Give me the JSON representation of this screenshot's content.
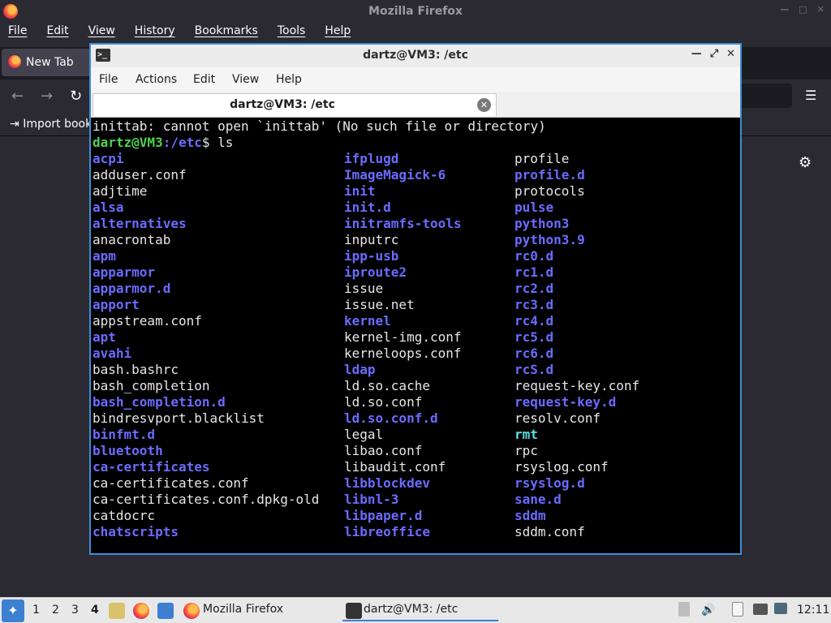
{
  "firefox": {
    "window_title": "Mozilla Firefox",
    "menu": [
      "File",
      "Edit",
      "View",
      "History",
      "Bookmarks",
      "Tools",
      "Help"
    ],
    "tab_label": "New Tab",
    "bookmark_label": "Import book"
  },
  "terminal": {
    "window_title": "dartz@VM3: /etc",
    "menu": [
      "File",
      "Actions",
      "Edit",
      "View",
      "Help"
    ],
    "tab_label": "dartz@VM3: /etc",
    "error_line": "inittab: cannot open `inittab' (No such file or directory)",
    "prompt_user": "dartz@VM3",
    "prompt_path": ":/etc",
    "prompt_rest": "$ ls",
    "columns": [
      [
        {
          "name": "acpi",
          "type": "dir"
        },
        {
          "name": "adduser.conf",
          "type": "file"
        },
        {
          "name": "adjtime",
          "type": "file"
        },
        {
          "name": "alsa",
          "type": "dir"
        },
        {
          "name": "alternatives",
          "type": "dir"
        },
        {
          "name": "anacrontab",
          "type": "file"
        },
        {
          "name": "apm",
          "type": "dir"
        },
        {
          "name": "apparmor",
          "type": "dir"
        },
        {
          "name": "apparmor.d",
          "type": "dir"
        },
        {
          "name": "apport",
          "type": "dir"
        },
        {
          "name": "appstream.conf",
          "type": "file"
        },
        {
          "name": "apt",
          "type": "dir"
        },
        {
          "name": "avahi",
          "type": "dir"
        },
        {
          "name": "bash.bashrc",
          "type": "file"
        },
        {
          "name": "bash_completion",
          "type": "file"
        },
        {
          "name": "bash_completion.d",
          "type": "dir"
        },
        {
          "name": "bindresvport.blacklist",
          "type": "file"
        },
        {
          "name": "binfmt.d",
          "type": "dir"
        },
        {
          "name": "bluetooth",
          "type": "dir"
        },
        {
          "name": "ca-certificates",
          "type": "dir"
        },
        {
          "name": "ca-certificates.conf",
          "type": "file"
        },
        {
          "name": "ca-certificates.conf.dpkg-old",
          "type": "file"
        },
        {
          "name": "catdocrc",
          "type": "file"
        },
        {
          "name": "chatscripts",
          "type": "dir"
        }
      ],
      [
        {
          "name": "ifplugd",
          "type": "dir"
        },
        {
          "name": "ImageMagick-6",
          "type": "dir"
        },
        {
          "name": "init",
          "type": "dir"
        },
        {
          "name": "init.d",
          "type": "dir"
        },
        {
          "name": "initramfs-tools",
          "type": "dir"
        },
        {
          "name": "inputrc",
          "type": "file"
        },
        {
          "name": "ipp-usb",
          "type": "dir"
        },
        {
          "name": "iproute2",
          "type": "dir"
        },
        {
          "name": "issue",
          "type": "file"
        },
        {
          "name": "issue.net",
          "type": "file"
        },
        {
          "name": "kernel",
          "type": "dir"
        },
        {
          "name": "kernel-img.conf",
          "type": "file"
        },
        {
          "name": "kerneloops.conf",
          "type": "file"
        },
        {
          "name": "ldap",
          "type": "dir"
        },
        {
          "name": "ld.so.cache",
          "type": "file"
        },
        {
          "name": "ld.so.conf",
          "type": "file"
        },
        {
          "name": "ld.so.conf.d",
          "type": "dir"
        },
        {
          "name": "legal",
          "type": "file"
        },
        {
          "name": "libao.conf",
          "type": "file"
        },
        {
          "name": "libaudit.conf",
          "type": "file"
        },
        {
          "name": "libblockdev",
          "type": "dir"
        },
        {
          "name": "libnl-3",
          "type": "dir"
        },
        {
          "name": "libpaper.d",
          "type": "dir"
        },
        {
          "name": "libreoffice",
          "type": "dir"
        }
      ],
      [
        {
          "name": "profile",
          "type": "file"
        },
        {
          "name": "profile.d",
          "type": "dir"
        },
        {
          "name": "protocols",
          "type": "file"
        },
        {
          "name": "pulse",
          "type": "dir"
        },
        {
          "name": "python3",
          "type": "dir"
        },
        {
          "name": "python3.9",
          "type": "dir"
        },
        {
          "name": "rc0.d",
          "type": "dir"
        },
        {
          "name": "rc1.d",
          "type": "dir"
        },
        {
          "name": "rc2.d",
          "type": "dir"
        },
        {
          "name": "rc3.d",
          "type": "dir"
        },
        {
          "name": "rc4.d",
          "type": "dir"
        },
        {
          "name": "rc5.d",
          "type": "dir"
        },
        {
          "name": "rc6.d",
          "type": "dir"
        },
        {
          "name": "rcS.d",
          "type": "dir"
        },
        {
          "name": "request-key.conf",
          "type": "file"
        },
        {
          "name": "request-key.d",
          "type": "dir"
        },
        {
          "name": "resolv.conf",
          "type": "file"
        },
        {
          "name": "rmt",
          "type": "special"
        },
        {
          "name": "rpc",
          "type": "file"
        },
        {
          "name": "rsyslog.conf",
          "type": "file"
        },
        {
          "name": "rsyslog.d",
          "type": "dir"
        },
        {
          "name": "sane.d",
          "type": "dir"
        },
        {
          "name": "sddm",
          "type": "dir"
        },
        {
          "name": "sddm.conf",
          "type": "file"
        }
      ]
    ]
  },
  "taskbar": {
    "workspaces": [
      "1",
      "2",
      "3",
      "4"
    ],
    "active_workspace": "4",
    "tasks": [
      {
        "label": "Mozilla Firefox",
        "icon": "firefox-icon"
      },
      {
        "label": "dartz@VM3: /etc",
        "icon": "terminal-icon"
      }
    ],
    "clock": "12:11"
  }
}
